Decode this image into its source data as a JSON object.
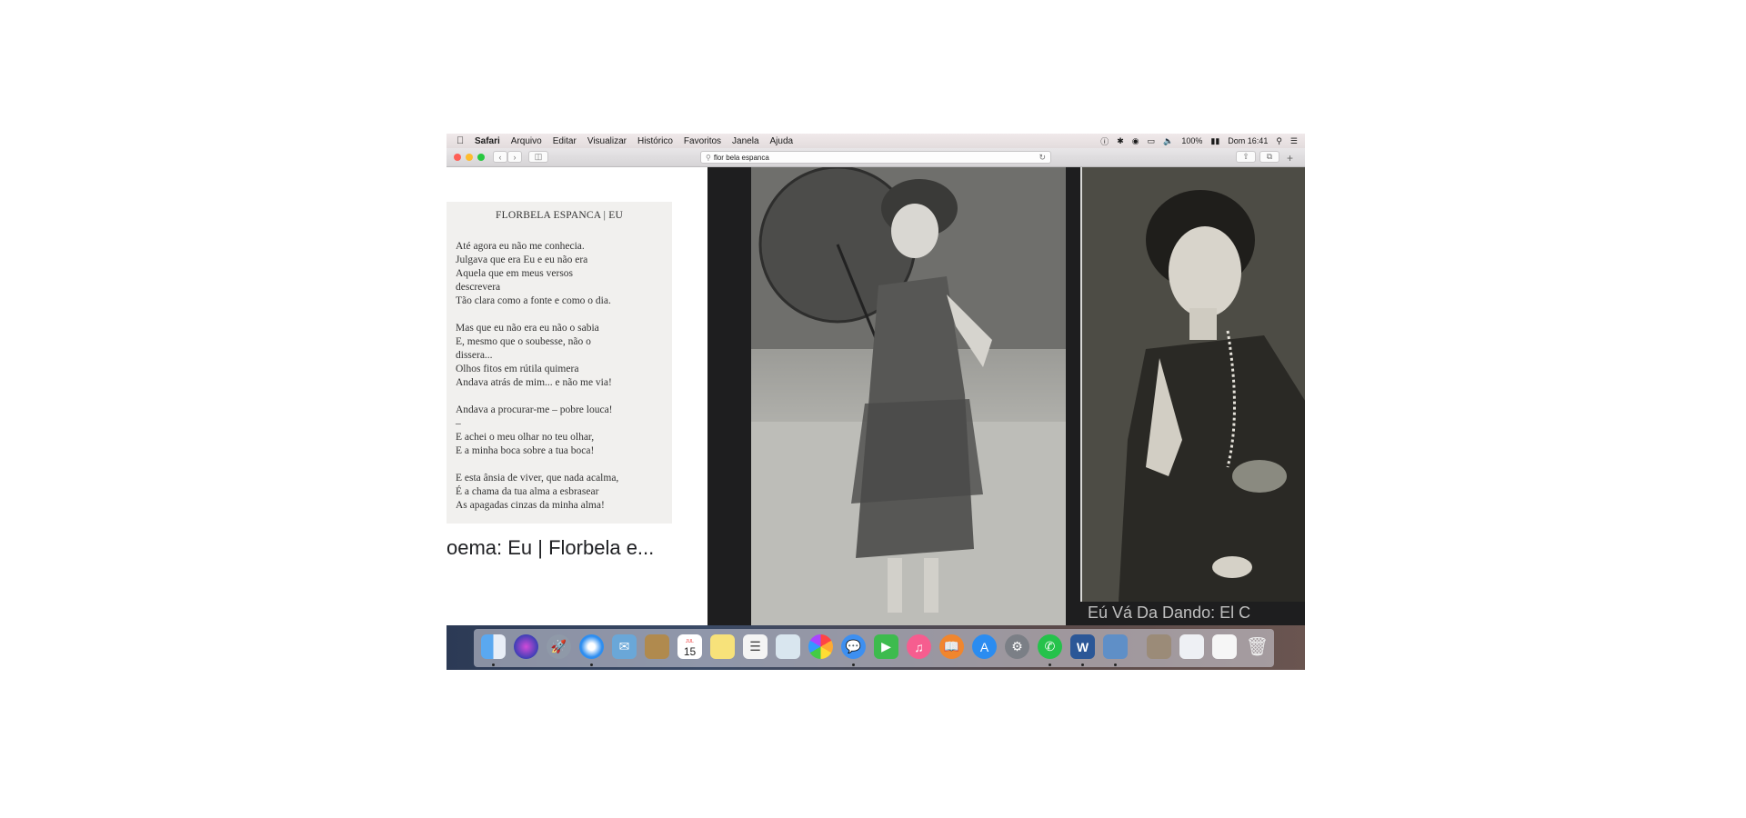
{
  "menubar": {
    "app": "Safari",
    "items": [
      "Arquivo",
      "Editar",
      "Visualizar",
      "Histórico",
      "Favoritos",
      "Janela",
      "Ajuda"
    ],
    "battery": "100%",
    "clock": "Dom 16:41"
  },
  "toolbar": {
    "address": "flor bela espanca",
    "new_tab": "+"
  },
  "poem": {
    "title": "FLORBELA ESPANCA | EU",
    "stanzas": [
      [
        "Até agora eu não me conhecia.",
        "Julgava que era Eu e eu não era",
        "Aquela que em meus versos",
        "descrevera",
        "Tão clara como a fonte e como o dia."
      ],
      [
        "Mas que eu não era eu não o sabia",
        "E, mesmo que o soubesse, não o",
        "dissera...",
        "Olhos fitos em rútila quimera",
        "Andava atrás de mim... e não me via!"
      ],
      [
        "Andava a procurar-me – pobre louca!",
        "–",
        "E achei o meu olhar no teu olhar,",
        "E a minha boca sobre a tua boca!"
      ],
      [
        "E esta ânsia de viver, que nada acalma,",
        "É a chama da tua alma a esbrasear",
        "As apagadas cinzas da minha alma!"
      ]
    ]
  },
  "results": {
    "caption": "oema: Eu | Florbela e...",
    "caption2": "Eú Vá Da Dando: El C"
  },
  "dock": {
    "calendar_day": "15",
    "calendar_month": "JUL",
    "apps": [
      "finder-icon",
      "siri-icon",
      "launchpad-icon",
      "safari-icon",
      "mail-icon",
      "contacts-icon",
      "calendar-icon",
      "notes-icon",
      "reminders-icon",
      "preview-icon",
      "photos-icon",
      "messages-icon",
      "facetime-icon",
      "itunes-icon",
      "ibooks-icon",
      "appstore-icon",
      "system-preferences-icon",
      "whatsapp-icon",
      "word-icon",
      "image-capture-icon",
      "folder-icon",
      "document-icon",
      "file-icon",
      "trash-icon"
    ]
  },
  "colors": {
    "close": "#fe5f57",
    "minimize": "#febc2e",
    "zoom": "#28c840",
    "dock_accent": "#3b82f6"
  }
}
